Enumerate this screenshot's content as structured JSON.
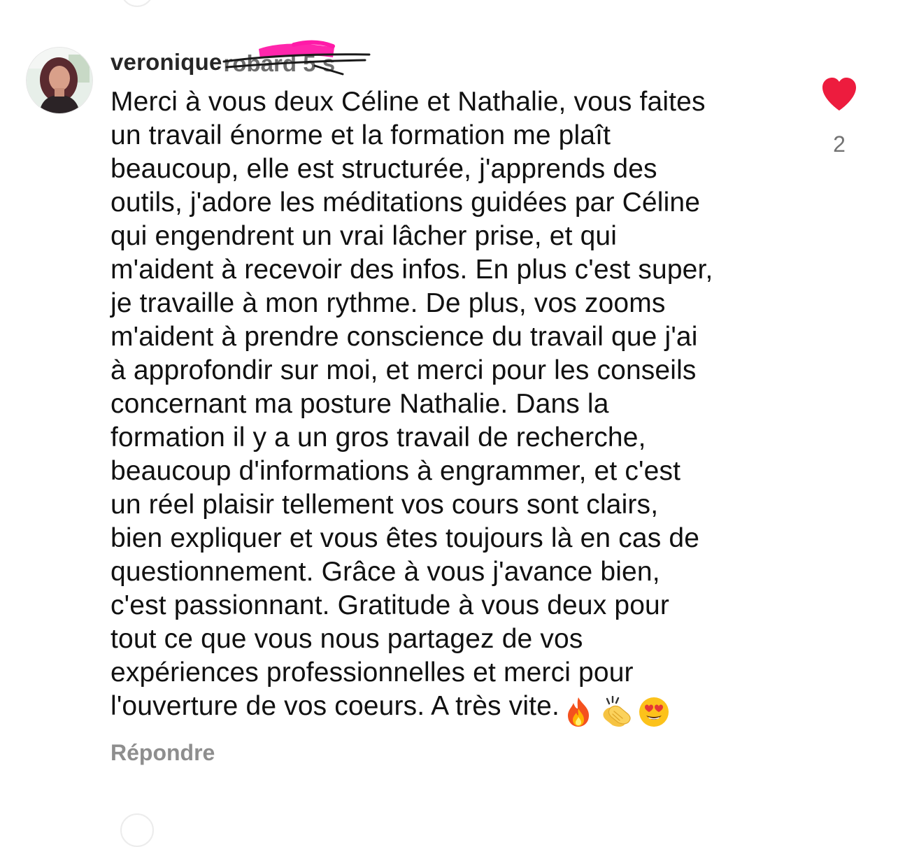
{
  "comment": {
    "username": "veronique",
    "username_redacted_suffix": "robard 5 s",
    "text": "Merci à vous deux Céline et Nathalie, vous faites\nun travail énorme et la formation me plaît\nbeaucoup, elle est structurée, j'apprends des\noutils, j'adore les méditations guidées par Céline\nqui engendrent un vrai lâcher prise, et qui\nm'aident à recevoir des infos. En plus c'est super,\nje travaille à mon rythme. De plus, vos zooms\nm'aident à prendre conscience du travail que j'ai\nà approfondir sur moi, et merci pour les conseils\nconcernant ma posture Nathalie. Dans la\nformation il y a un gros travail de recherche,\nbeaucoup d'informations à engrammer, et c'est\nun réel plaisir tellement vos cours sont clairs,\nbien expliquer et vous êtes toujours là en cas de\nquestionnement. Grâce à vous j'avance bien,\nc'est passionnant. Gratitude à vous deux pour\ntout ce que vous nous partagez de vos\nexpériences professionnelles et merci pour\nl'ouverture de vos coeurs. A très vite.",
    "emojis": [
      "fire-emoji",
      "clapping-hands-emoji",
      "heart-eyes-emoji"
    ],
    "likes": "2",
    "liked": true,
    "reply_label": "Répondre"
  },
  "colors": {
    "like_heart": "#ed1c3e",
    "redaction_marker": "#ff1aa8",
    "username": "#262626",
    "reply": "#8e8e8e",
    "count": "#737373"
  }
}
